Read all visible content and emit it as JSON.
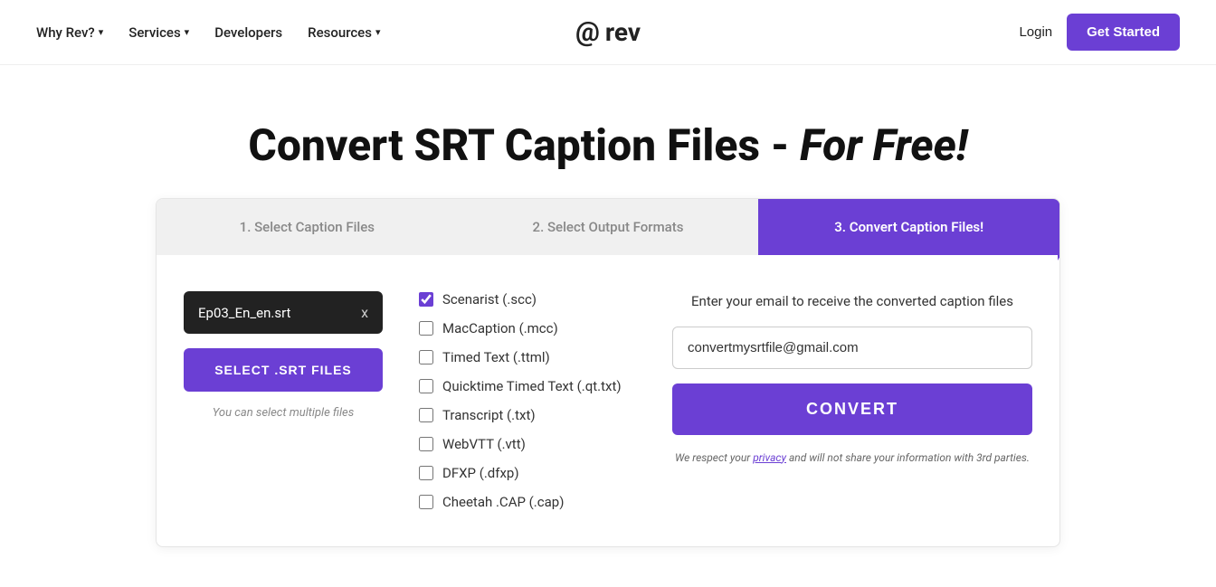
{
  "nav": {
    "items": [
      {
        "label": "Why Rev?",
        "hasDropdown": true
      },
      {
        "label": "Services",
        "hasDropdown": true
      },
      {
        "label": "Developers",
        "hasDropdown": false
      },
      {
        "label": "Resources",
        "hasDropdown": true
      }
    ],
    "logo_text": "rev",
    "login_label": "Login",
    "get_started_label": "Get Started"
  },
  "page": {
    "title_start": "Convert SRT Caption Files - ",
    "title_italic": "For Free!"
  },
  "steps": [
    {
      "label": "1. Select Caption Files",
      "active": false
    },
    {
      "label": "2. Select Output Formats",
      "active": false
    },
    {
      "label": "3. Convert Caption Files!",
      "active": true
    }
  ],
  "file": {
    "name": "Ep03_En_en.srt",
    "close_label": "x"
  },
  "select_btn_label": "SELECT .SRT FILES",
  "select_hint": "You can select multiple files",
  "formats": [
    {
      "label": "Scenarist (.scc)",
      "checked": true
    },
    {
      "label": "MacCaption (.mcc)",
      "checked": false
    },
    {
      "label": "Timed Text (.ttml)",
      "checked": false
    },
    {
      "label": "Quicktime Timed Text (.qt.txt)",
      "checked": false
    },
    {
      "label": "Transcript (.txt)",
      "checked": false
    },
    {
      "label": "WebVTT (.vtt)",
      "checked": false
    },
    {
      "label": "DFXP (.dfxp)",
      "checked": false
    },
    {
      "label": "Cheetah .CAP (.cap)",
      "checked": false
    }
  ],
  "email_section": {
    "label": "Enter your email to receive the converted caption files",
    "placeholder": "convertmysrtfile@gmail.com",
    "value": "convertmysrtfile@gmail.com",
    "convert_label": "CONVERT",
    "privacy_text_before": "We respect your ",
    "privacy_link": "privacy",
    "privacy_text_after": " and will not share your information with 3rd parties."
  }
}
